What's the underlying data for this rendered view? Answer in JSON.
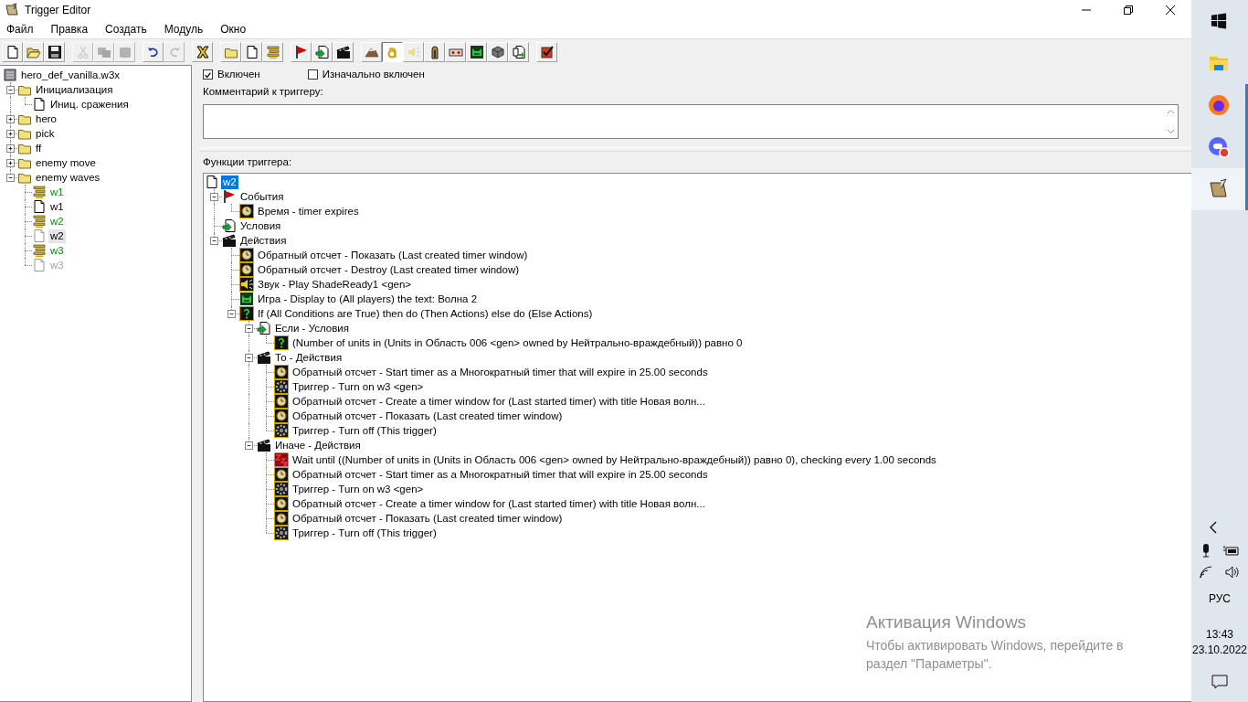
{
  "window": {
    "title": "Trigger Editor"
  },
  "menu": [
    {
      "label": "Файл"
    },
    {
      "label": "Правка"
    },
    {
      "label": "Создать"
    },
    {
      "label": "Модуль"
    },
    {
      "label": "Окно"
    }
  ],
  "toolbar": [
    [
      {
        "kind": "page",
        "disabled": false,
        "pressed": false
      },
      {
        "kind": "folder-open",
        "disabled": false,
        "pressed": false
      },
      {
        "kind": "floppy",
        "disabled": false,
        "pressed": false
      }
    ],
    [
      {
        "kind": "scissors",
        "disabled": true,
        "pressed": false
      },
      {
        "kind": "copy",
        "disabled": true,
        "pressed": false
      },
      {
        "kind": "paste",
        "disabled": true,
        "pressed": false
      }
    ],
    [
      {
        "kind": "undo",
        "disabled": false,
        "pressed": false
      },
      {
        "kind": "redo",
        "disabled": true,
        "pressed": false
      }
    ],
    [
      {
        "kind": "cross",
        "disabled": false,
        "pressed": false
      }
    ],
    [
      {
        "kind": "folder",
        "disabled": false,
        "pressed": false
      },
      {
        "kind": "page",
        "disabled": false,
        "pressed": false
      },
      {
        "kind": "bars",
        "disabled": false,
        "pressed": false
      }
    ],
    [
      {
        "kind": "flag",
        "disabled": false,
        "pressed": false
      },
      {
        "kind": "page-arrow",
        "disabled": false,
        "pressed": false
      },
      {
        "kind": "clapper",
        "disabled": false,
        "pressed": false
      }
    ],
    [
      {
        "kind": "mountain",
        "disabled": false,
        "pressed": false
      },
      {
        "kind": "letter",
        "disabled": false,
        "pressed": true
      },
      {
        "kind": "speaker-pale",
        "disabled": false,
        "pressed": false
      },
      {
        "kind": "statue",
        "disabled": false,
        "pressed": false
      },
      {
        "kind": "panel",
        "disabled": false,
        "pressed": false
      },
      {
        "kind": "monster",
        "disabled": false,
        "pressed": false
      },
      {
        "kind": "cube",
        "disabled": false,
        "pressed": false
      },
      {
        "kind": "pages-arrow",
        "disabled": false,
        "pressed": false
      }
    ],
    [
      {
        "kind": "checklist",
        "disabled": false,
        "pressed": false
      }
    ]
  ],
  "map_tree": {
    "items": [
      {
        "kind": "map",
        "label": "hero_def_vanilla.w3x",
        "selected": false,
        "children": [
          {
            "kind": "folder",
            "label": "Инициализация",
            "selected": false,
            "expanded": true,
            "children": [
              {
                "kind": "trigger",
                "label": "Иниц. сражения",
                "selected": false,
                "initially_on": true,
                "enabled": true
              }
            ]
          },
          {
            "kind": "folder",
            "label": "hero",
            "selected": false,
            "expanded": false
          },
          {
            "kind": "folder",
            "label": "pick",
            "selected": false,
            "expanded": false
          },
          {
            "kind": "folder",
            "label": "ff",
            "selected": false,
            "expanded": false
          },
          {
            "kind": "folder",
            "label": "enemy move",
            "selected": false,
            "expanded": false
          },
          {
            "kind": "folder",
            "label": "enemy waves",
            "selected": false,
            "expanded": true,
            "children": [
              {
                "kind": "comment",
                "label": "w1",
                "selected": false
              },
              {
                "kind": "trigger",
                "label": "w1",
                "selected": false,
                "initially_on": true,
                "enabled": true
              },
              {
                "kind": "comment",
                "label": "w2",
                "selected": false
              },
              {
                "kind": "trigger",
                "label": "w2",
                "selected": true,
                "initially_on": false,
                "enabled": true
              },
              {
                "kind": "comment",
                "label": "w3",
                "selected": false
              },
              {
                "kind": "trigger",
                "label": "w3",
                "selected": false,
                "initially_on": false,
                "enabled": false
              }
            ]
          }
        ]
      }
    ]
  },
  "trigger": {
    "enabled": {
      "label": "Включен",
      "checked": true
    },
    "initially_on": {
      "label": "Изначально включен",
      "checked": false
    },
    "comment_label": "Комментарий к триггеру:",
    "functions_label": "Функции триггера:"
  },
  "functions": {
    "items": [
      {
        "kind": "page",
        "label": "w2",
        "selected": true,
        "children": [
          {
            "kind": "flag",
            "label": "События",
            "selected": false,
            "expanded": true,
            "children": [
              {
                "kind": "clock",
                "label": "Время - timer expires",
                "selected": false
              }
            ]
          },
          {
            "kind": "page-arrow",
            "label": "Условия",
            "selected": false
          },
          {
            "kind": "clapper",
            "label": "Действия",
            "selected": false,
            "expanded": true,
            "children": [
              {
                "kind": "clock",
                "label": "Обратный отсчет - Показать (Last created timer window)",
                "selected": false
              },
              {
                "kind": "clock",
                "label": "Обратный отсчет - Destroy (Last created timer window)",
                "selected": false
              },
              {
                "kind": "speaker",
                "label": "Звук - Play ShadeReady1 <gen>",
                "selected": false
              },
              {
                "kind": "monster",
                "label": "Игра - Display to (All players) the text: Волна 2",
                "selected": false
              },
              {
                "kind": "question",
                "label": "If (All Conditions are True) then do (Then Actions) else do (Else Actions)",
                "selected": false,
                "expanded": true,
                "children": [
                  {
                    "kind": "page-arrow",
                    "label": "Если - Условия",
                    "selected": false,
                    "expanded": true,
                    "children": [
                      {
                        "kind": "question",
                        "label": "(Number of units in (Units in Область 006 <gen> owned by Нейтрально-враждебный)) равно 0",
                        "selected": false
                      }
                    ]
                  },
                  {
                    "kind": "clapper",
                    "label": "То - Действия",
                    "selected": false,
                    "expanded": true,
                    "children": [
                      {
                        "kind": "clock",
                        "label": "Обратный отсчет - Start timer as a Многократный timer that will expire in 25.00 seconds",
                        "selected": false
                      },
                      {
                        "kind": "gear",
                        "label": "Триггер - Turn on w3 <gen>",
                        "selected": false
                      },
                      {
                        "kind": "clock",
                        "label": "Обратный отсчет - Create a timer window for (Last started timer) with title Новая волн...",
                        "selected": false
                      },
                      {
                        "kind": "clock",
                        "label": "Обратный отсчет - Показать (Last created timer window)",
                        "selected": false
                      },
                      {
                        "kind": "gear",
                        "label": "Триггер - Turn off (This trigger)",
                        "selected": false
                      }
                    ]
                  },
                  {
                    "kind": "clapper",
                    "label": "Иначе - Действия",
                    "selected": false,
                    "expanded": true,
                    "children": [
                      {
                        "kind": "sleep",
                        "label": "Wait until ((Number of units in (Units in Область 006 <gen> owned by Нейтрально-враждебный)) равно 0), checking every 1.00 seconds",
                        "selected": false
                      },
                      {
                        "kind": "clock",
                        "label": "Обратный отсчет - Start timer as a Многократный timer that will expire in 25.00 seconds",
                        "selected": false
                      },
                      {
                        "kind": "gear",
                        "label": "Триггер - Turn on w3 <gen>",
                        "selected": false
                      },
                      {
                        "kind": "clock",
                        "label": "Обратный отсчет - Create a timer window for (Last started timer) with title Новая волн...",
                        "selected": false
                      },
                      {
                        "kind": "clock",
                        "label": "Обратный отсчет - Показать (Last created timer window)",
                        "selected": false
                      },
                      {
                        "kind": "gear",
                        "label": "Триггер - Turn off (This trigger)",
                        "selected": false
                      }
                    ]
                  }
                ]
              }
            ]
          }
        ]
      }
    ]
  },
  "taskbar": {
    "apps": [
      {
        "kind": "start",
        "running": false,
        "selected": false
      },
      {
        "kind": "explorer",
        "running": false,
        "selected": false
      },
      {
        "kind": "browser",
        "running": true,
        "selected": false
      },
      {
        "kind": "chat",
        "running": true,
        "selected": false
      },
      {
        "kind": "scroll",
        "running": true,
        "selected": true
      }
    ],
    "language": "РУС",
    "time": "13:43",
    "date": "23.10.2022"
  },
  "activation": {
    "title": "Активация Windows",
    "lines": [
      "Чтобы активировать Windows, перейдите в",
      "раздел \"Параметры\"."
    ]
  }
}
